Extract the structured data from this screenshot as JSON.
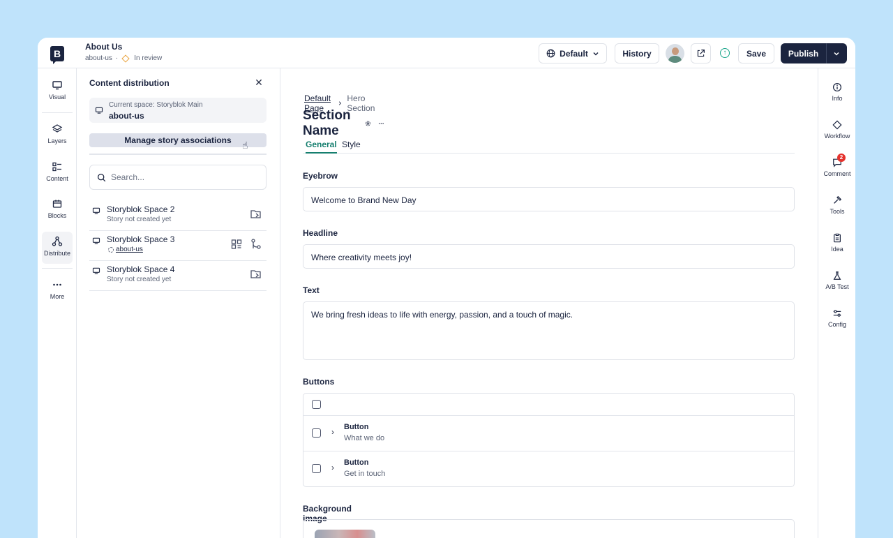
{
  "header": {
    "story_title": "About Us",
    "story_slug": "about-us",
    "separator": "·",
    "status": "In review",
    "language_label": "Default",
    "history_label": "History",
    "save_label": "Save",
    "publish_label": "Publish"
  },
  "left_rail": {
    "items": [
      {
        "label": "Visual",
        "icon": "monitor-icon"
      },
      {
        "label": "Layers",
        "icon": "layers-icon"
      },
      {
        "label": "Content",
        "icon": "list-icon"
      },
      {
        "label": "Blocks",
        "icon": "blocks-icon"
      },
      {
        "label": "Distribute",
        "icon": "share-icon",
        "active": true
      },
      {
        "label": "More",
        "icon": "more-icon"
      }
    ]
  },
  "panel": {
    "title": "Content distribution",
    "current_space_label": "Current space: Storyblok Main",
    "current_space_value": "about-us",
    "manage_label": "Manage story associations",
    "search_placeholder": "Search...",
    "spaces": [
      {
        "name": "Storyblok Space 2",
        "sub": "Story not created yet"
      },
      {
        "name": "Storyblok Space 3",
        "sub": "about-us"
      },
      {
        "name": "Storyblok Space 4",
        "sub": "Story not created yet"
      }
    ]
  },
  "main": {
    "breadcrumb": [
      "Default Page",
      "Hero Section"
    ],
    "section_title": "Section Name",
    "tabs": [
      "General",
      "Style"
    ],
    "fields": {
      "eyebrow_label": "Eyebrow",
      "eyebrow_value": "Welcome to Brand New Day",
      "headline_label": "Headline",
      "headline_value": "Where creativity meets joy!",
      "text_label": "Text",
      "text_value": "We bring fresh ideas to life with energy, passion, and a touch of magic.",
      "buttons_label": "Buttons",
      "buttons": [
        {
          "title": "Button",
          "sub": "What we do"
        },
        {
          "title": "Button",
          "sub": "Get in touch"
        }
      ],
      "background_label": "Background image"
    }
  },
  "right_rail": {
    "items": [
      {
        "label": "Info",
        "icon": "info-icon"
      },
      {
        "label": "Workflow",
        "icon": "workflow-icon"
      },
      {
        "label": "Comment",
        "icon": "comment-icon",
        "badge": "2"
      },
      {
        "label": "Tools",
        "icon": "tools-icon"
      },
      {
        "label": "Idea",
        "icon": "idea-icon"
      },
      {
        "label": "A/B Test",
        "icon": "flask-icon"
      },
      {
        "label": "Config",
        "icon": "sliders-icon"
      }
    ]
  },
  "colors": {
    "background": "#bfe3fb",
    "primary": "#1b243f",
    "accent": "#167f6f",
    "status": "#e9a23b",
    "badge": "#e5322d"
  }
}
